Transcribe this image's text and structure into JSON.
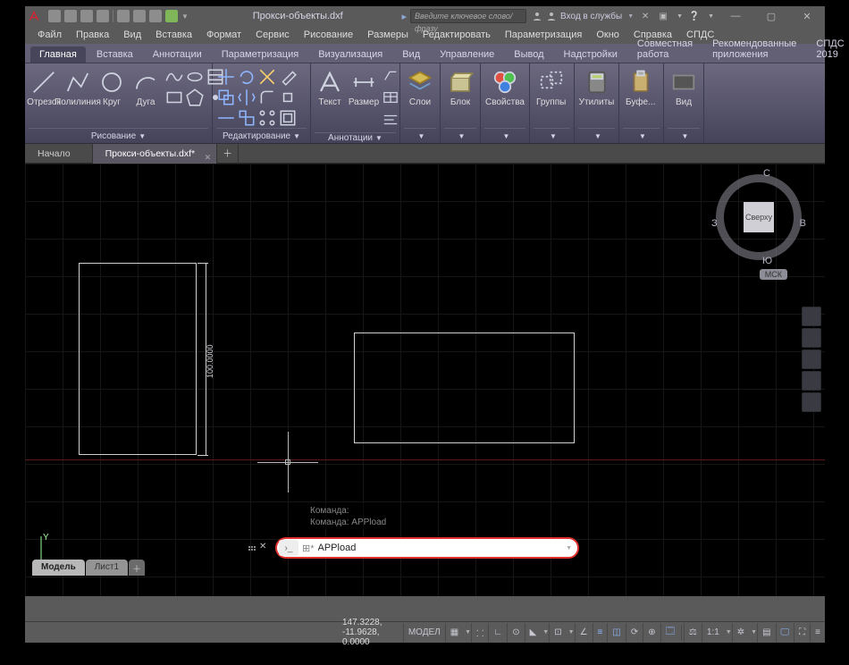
{
  "title": "Прокси-объекты.dxf",
  "search_placeholder": "Введите ключевое слово/фразу",
  "signin": "Вход в службы",
  "menubar": [
    "Файл",
    "Правка",
    "Вид",
    "Вставка",
    "Формат",
    "Сервис",
    "Рисование",
    "Размеры",
    "Редактировать",
    "Параметризация",
    "Окно",
    "Справка",
    "СПДС"
  ],
  "ribbon_tabs": [
    "Главная",
    "Вставка",
    "Аннотации",
    "Параметризация",
    "Визуализация",
    "Вид",
    "Управление",
    "Вывод",
    "Надстройки",
    "Совместная работа",
    "Рекомендованные приложения",
    "СПДС 2019"
  ],
  "ribbon_active_tab": 0,
  "panels": {
    "draw": {
      "label": "Рисование",
      "items": [
        "Отрезок",
        "Полилиния",
        "Круг",
        "Дуга"
      ]
    },
    "edit": {
      "label": "Редактирование"
    },
    "annot": {
      "label": "Аннотации",
      "items": [
        "Текст",
        "Размер"
      ]
    },
    "layers": {
      "label": "Слои"
    },
    "block": {
      "label": "Блок"
    },
    "props": {
      "label": "Свойства"
    },
    "groups": {
      "label": "Группы"
    },
    "utils": {
      "label": "Утилиты"
    },
    "clip": {
      "label": "Буфе..."
    },
    "view": {
      "label": "Вид"
    }
  },
  "doc_tabs": [
    {
      "label": "Начало",
      "active": false
    },
    {
      "label": "Прокси-объекты.dxf*",
      "active": true
    }
  ],
  "viewcube": {
    "face": "Сверху",
    "n": "С",
    "s": "Ю",
    "e": "В",
    "w": "З",
    "wcs": "МСК"
  },
  "dimension_text": "100.0000",
  "cmd_history": [
    "Команда:",
    "Команда: APPload"
  ],
  "cmd_input": "APPload",
  "model_tabs": [
    "Модель",
    "Лист1"
  ],
  "model_active": 0,
  "status": {
    "coords": "147.3228, -11.9628, 0.0000",
    "space": "МОДЕЛ",
    "scale": "1:1"
  },
  "colors": {
    "accent": "#e13030",
    "ribbon": "#615e75"
  }
}
